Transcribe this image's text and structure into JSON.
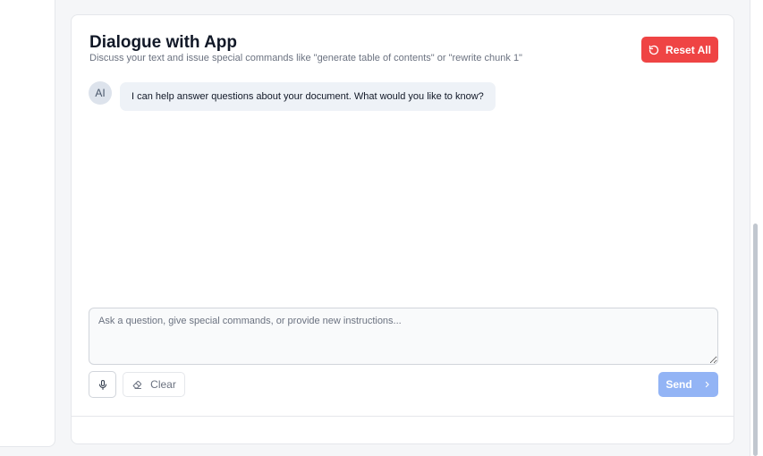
{
  "dialogue": {
    "title": "Dialogue with App",
    "subtitle": "Discuss your text and issue special commands like \"generate table of contents\" or \"rewrite chunk 1\"",
    "reset_label": "Reset All",
    "messages": [
      {
        "sender": "AI",
        "text": "I can help answer questions about your document. What would you like to know?"
      }
    ]
  },
  "composer": {
    "placeholder": "Ask a question, give special commands, or provide new instructions...",
    "value": "",
    "clear_label": "Clear",
    "send_label": "Send"
  },
  "icons": {
    "reset": "refresh-icon",
    "mic": "microphone-icon",
    "clear": "eraser-icon",
    "send": "chevron-right-icon"
  },
  "colors": {
    "reset_button": "#ef4444",
    "send_button_disabled": "#93b4f5",
    "bubble": "#eef2f7",
    "avatar": "#dde3ec"
  }
}
